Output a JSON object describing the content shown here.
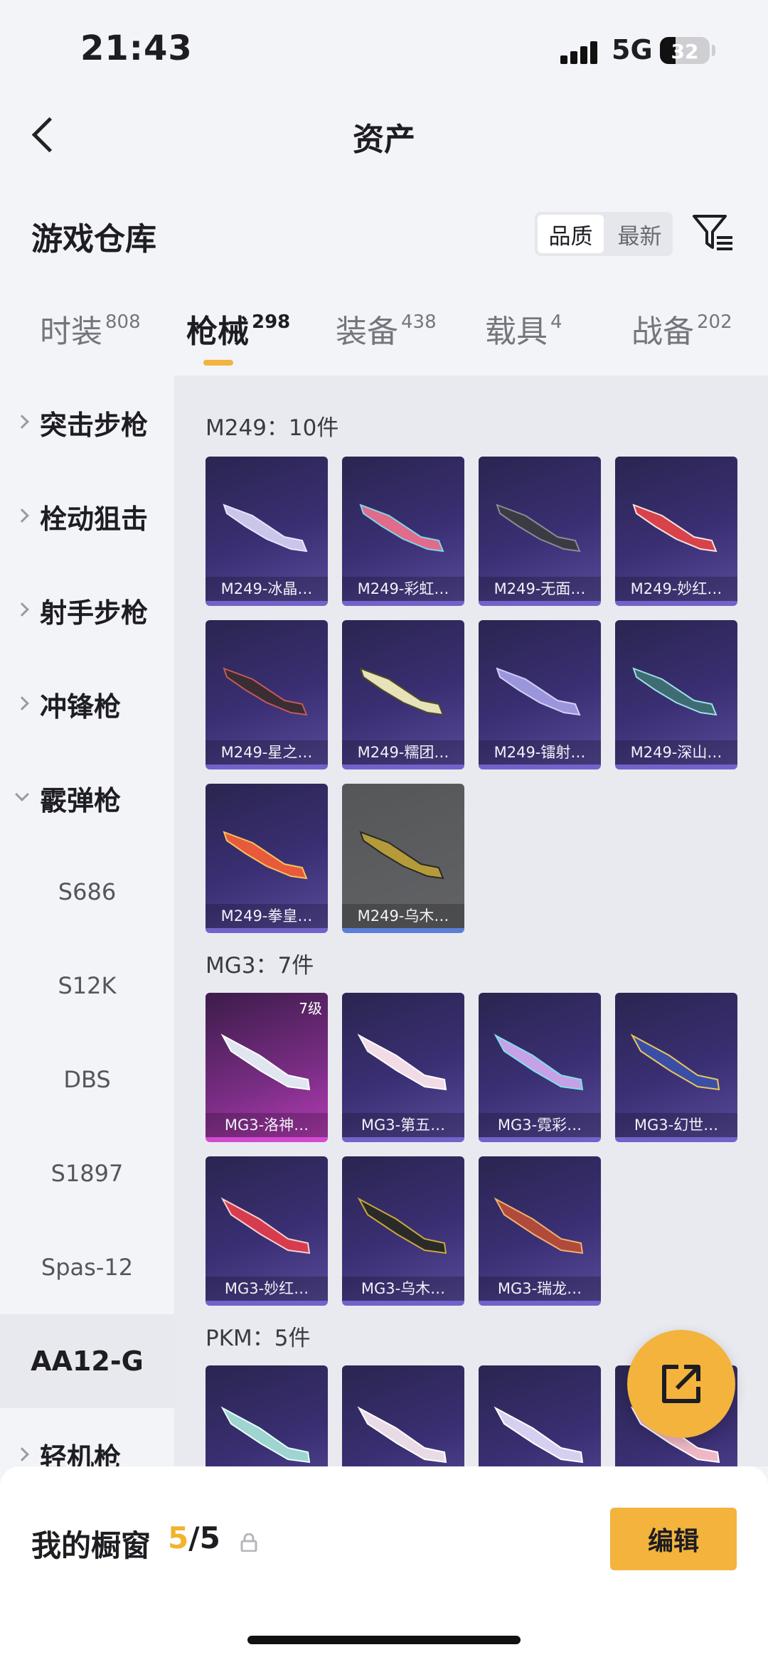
{
  "status": {
    "time": "21:43",
    "network": "5G",
    "battery": "32"
  },
  "nav": {
    "title": "资产"
  },
  "warehouse": {
    "title": "游戏仓库",
    "sort_quality": "品质",
    "sort_newest": "最新"
  },
  "tabs": [
    {
      "label": "时装",
      "count": "808"
    },
    {
      "label": "枪械",
      "count": "298"
    },
    {
      "label": "装备",
      "count": "438"
    },
    {
      "label": "载具",
      "count": "4"
    },
    {
      "label": "战备",
      "count": "202"
    }
  ],
  "sidebar": {
    "categories": [
      "突击步枪",
      "栓动狙击",
      "射手步枪",
      "冲锋枪",
      "霰弹枪"
    ],
    "subitems": [
      "S686",
      "S12K",
      "DBS",
      "S1897",
      "Spas-12"
    ],
    "selected": "AA12-G",
    "last": "轻机枪"
  },
  "sections": [
    {
      "title": "M249：10件",
      "items": [
        "M249-冰晶…",
        "M249-彩虹…",
        "M249-无面…",
        "M249-妙红…",
        "M249-星之…",
        "M249-糯团…",
        "M249-镭射…",
        "M249-深山…",
        "M249-拳皇…",
        "M249-乌木…"
      ]
    },
    {
      "title": "MG3：7件",
      "items": [
        "MG3-洛神…",
        "MG3-第五…",
        "MG3-霓彩…",
        "MG3-幻世…",
        "MG3-妙红…",
        "MG3-乌木…",
        "MG3-瑞龙…"
      ],
      "first_level": "7级"
    },
    {
      "title": "PKM：5件"
    }
  ],
  "showcase": {
    "title": "我的橱窗",
    "current": "5",
    "total": "/5",
    "edit": "编辑"
  }
}
